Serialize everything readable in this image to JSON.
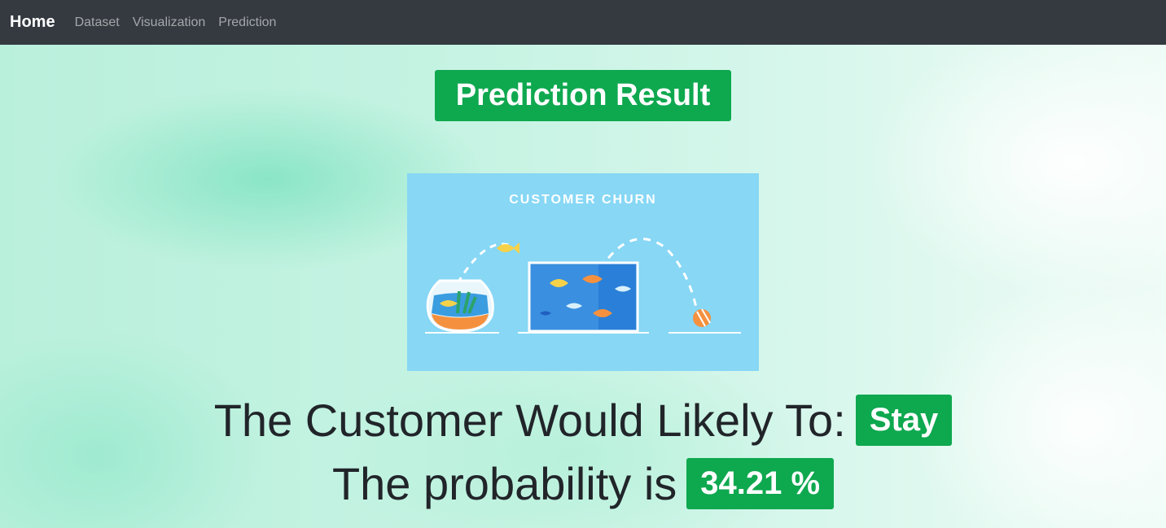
{
  "navbar": {
    "brand": "Home",
    "links": [
      "Dataset",
      "Visualization",
      "Prediction"
    ]
  },
  "header": {
    "title": "Prediction Result"
  },
  "hero": {
    "caption": "CUSTOMER CHURN"
  },
  "result": {
    "prefix": "The Customer Would Likely To:",
    "value": "Stay"
  },
  "probability": {
    "prefix": "The probability is",
    "value": "34.21 %"
  },
  "colors": {
    "navbar": "#343a40",
    "badge": "#0ea84f",
    "hero_bg": "#87d7f5"
  }
}
